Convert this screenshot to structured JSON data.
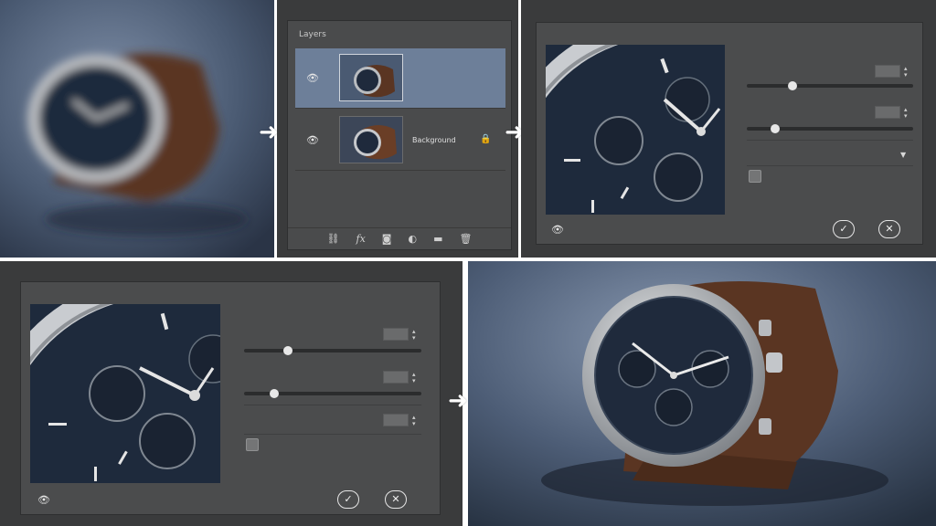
{
  "layers": {
    "title": "Layers",
    "layer_bottom_name": "Background",
    "footer_icons": [
      "link-icon",
      "fx-icon",
      "mask-icon",
      "adjustment-icon",
      "folder-icon",
      "trash-icon"
    ]
  },
  "icons": {
    "eye": "eye-icon",
    "lock": "lock-icon",
    "confirm": "checkmark-icon",
    "cancel": "close-icon"
  },
  "colors": {
    "dark_ui": "#4b4c4d",
    "selected_layer": "#6d7f99",
    "background_blue": "#4a5a72",
    "strap_brown": "#5a3522",
    "dial_navy": "#1f2a3c"
  }
}
